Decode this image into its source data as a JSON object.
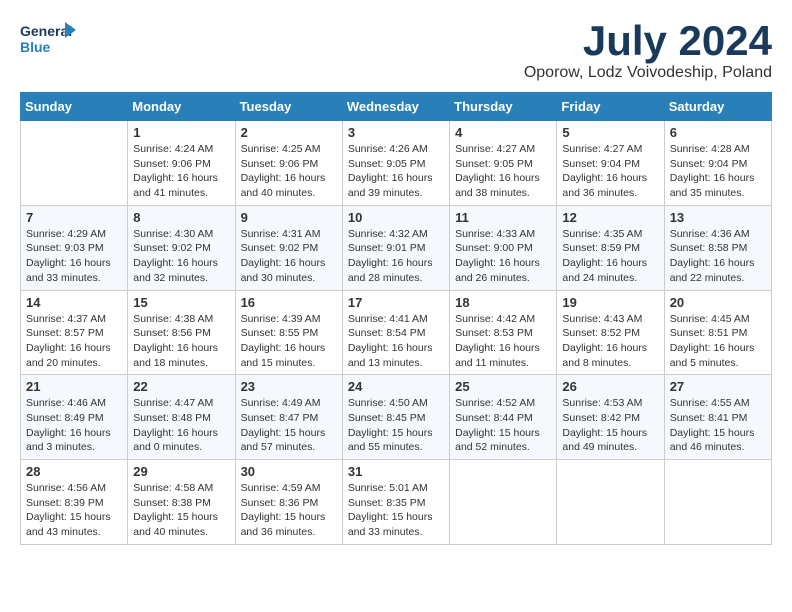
{
  "header": {
    "logo_line1": "General",
    "logo_line2": "Blue",
    "month_title": "July 2024",
    "location": "Oporow, Lodz Voivodeship, Poland"
  },
  "days_of_week": [
    "Sunday",
    "Monday",
    "Tuesday",
    "Wednesday",
    "Thursday",
    "Friday",
    "Saturday"
  ],
  "weeks": [
    [
      {
        "day": "",
        "info": ""
      },
      {
        "day": "1",
        "info": "Sunrise: 4:24 AM\nSunset: 9:06 PM\nDaylight: 16 hours and 41 minutes."
      },
      {
        "day": "2",
        "info": "Sunrise: 4:25 AM\nSunset: 9:06 PM\nDaylight: 16 hours and 40 minutes."
      },
      {
        "day": "3",
        "info": "Sunrise: 4:26 AM\nSunset: 9:05 PM\nDaylight: 16 hours and 39 minutes."
      },
      {
        "day": "4",
        "info": "Sunrise: 4:27 AM\nSunset: 9:05 PM\nDaylight: 16 hours and 38 minutes."
      },
      {
        "day": "5",
        "info": "Sunrise: 4:27 AM\nSunset: 9:04 PM\nDaylight: 16 hours and 36 minutes."
      },
      {
        "day": "6",
        "info": "Sunrise: 4:28 AM\nSunset: 9:04 PM\nDaylight: 16 hours and 35 minutes."
      }
    ],
    [
      {
        "day": "7",
        "info": "Sunrise: 4:29 AM\nSunset: 9:03 PM\nDaylight: 16 hours and 33 minutes."
      },
      {
        "day": "8",
        "info": "Sunrise: 4:30 AM\nSunset: 9:02 PM\nDaylight: 16 hours and 32 minutes."
      },
      {
        "day": "9",
        "info": "Sunrise: 4:31 AM\nSunset: 9:02 PM\nDaylight: 16 hours and 30 minutes."
      },
      {
        "day": "10",
        "info": "Sunrise: 4:32 AM\nSunset: 9:01 PM\nDaylight: 16 hours and 28 minutes."
      },
      {
        "day": "11",
        "info": "Sunrise: 4:33 AM\nSunset: 9:00 PM\nDaylight: 16 hours and 26 minutes."
      },
      {
        "day": "12",
        "info": "Sunrise: 4:35 AM\nSunset: 8:59 PM\nDaylight: 16 hours and 24 minutes."
      },
      {
        "day": "13",
        "info": "Sunrise: 4:36 AM\nSunset: 8:58 PM\nDaylight: 16 hours and 22 minutes."
      }
    ],
    [
      {
        "day": "14",
        "info": "Sunrise: 4:37 AM\nSunset: 8:57 PM\nDaylight: 16 hours and 20 minutes."
      },
      {
        "day": "15",
        "info": "Sunrise: 4:38 AM\nSunset: 8:56 PM\nDaylight: 16 hours and 18 minutes."
      },
      {
        "day": "16",
        "info": "Sunrise: 4:39 AM\nSunset: 8:55 PM\nDaylight: 16 hours and 15 minutes."
      },
      {
        "day": "17",
        "info": "Sunrise: 4:41 AM\nSunset: 8:54 PM\nDaylight: 16 hours and 13 minutes."
      },
      {
        "day": "18",
        "info": "Sunrise: 4:42 AM\nSunset: 8:53 PM\nDaylight: 16 hours and 11 minutes."
      },
      {
        "day": "19",
        "info": "Sunrise: 4:43 AM\nSunset: 8:52 PM\nDaylight: 16 hours and 8 minutes."
      },
      {
        "day": "20",
        "info": "Sunrise: 4:45 AM\nSunset: 8:51 PM\nDaylight: 16 hours and 5 minutes."
      }
    ],
    [
      {
        "day": "21",
        "info": "Sunrise: 4:46 AM\nSunset: 8:49 PM\nDaylight: 16 hours and 3 minutes."
      },
      {
        "day": "22",
        "info": "Sunrise: 4:47 AM\nSunset: 8:48 PM\nDaylight: 16 hours and 0 minutes."
      },
      {
        "day": "23",
        "info": "Sunrise: 4:49 AM\nSunset: 8:47 PM\nDaylight: 15 hours and 57 minutes."
      },
      {
        "day": "24",
        "info": "Sunrise: 4:50 AM\nSunset: 8:45 PM\nDaylight: 15 hours and 55 minutes."
      },
      {
        "day": "25",
        "info": "Sunrise: 4:52 AM\nSunset: 8:44 PM\nDaylight: 15 hours and 52 minutes."
      },
      {
        "day": "26",
        "info": "Sunrise: 4:53 AM\nSunset: 8:42 PM\nDaylight: 15 hours and 49 minutes."
      },
      {
        "day": "27",
        "info": "Sunrise: 4:55 AM\nSunset: 8:41 PM\nDaylight: 15 hours and 46 minutes."
      }
    ],
    [
      {
        "day": "28",
        "info": "Sunrise: 4:56 AM\nSunset: 8:39 PM\nDaylight: 15 hours and 43 minutes."
      },
      {
        "day": "29",
        "info": "Sunrise: 4:58 AM\nSunset: 8:38 PM\nDaylight: 15 hours and 40 minutes."
      },
      {
        "day": "30",
        "info": "Sunrise: 4:59 AM\nSunset: 8:36 PM\nDaylight: 15 hours and 36 minutes."
      },
      {
        "day": "31",
        "info": "Sunrise: 5:01 AM\nSunset: 8:35 PM\nDaylight: 15 hours and 33 minutes."
      },
      {
        "day": "",
        "info": ""
      },
      {
        "day": "",
        "info": ""
      },
      {
        "day": "",
        "info": ""
      }
    ]
  ]
}
